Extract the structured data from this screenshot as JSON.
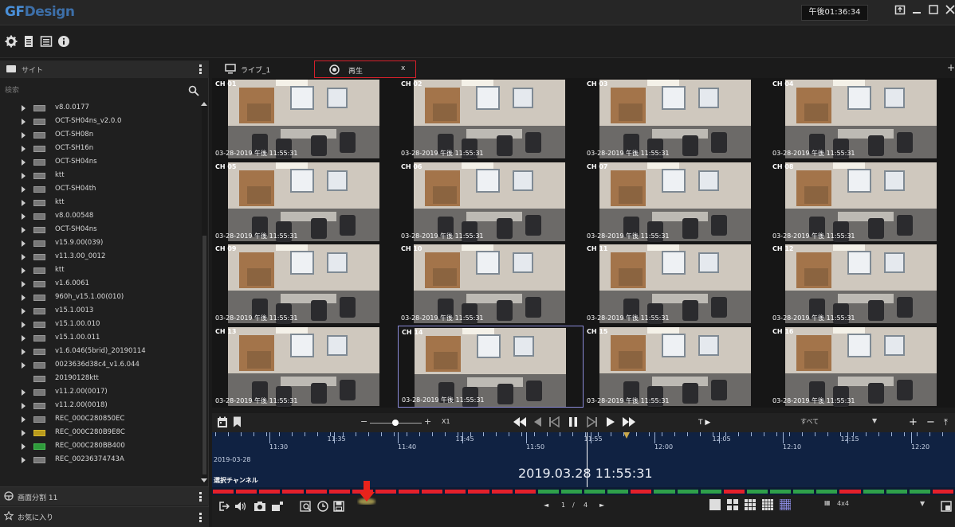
{
  "app": {
    "logo_gf": "GF",
    "logo_rest": "Design",
    "clock": "午後01:36:34"
  },
  "colors": {
    "accent": "#4a90d9",
    "tab_highlight": "#d6202b",
    "timeline_bg": "#102242",
    "record_red": "#e4202a",
    "record_green": "#2fa04a",
    "selected_cell": "#8a8ad8"
  },
  "toolbar": {
    "icons": [
      "gear-icon",
      "document-icon",
      "list-icon",
      "info-icon"
    ]
  },
  "sidebar": {
    "header_label": "サイト",
    "search_placeholder": "検索",
    "items": [
      {
        "label": "v8.0.0177",
        "color": "gray"
      },
      {
        "label": "OCT-SH04ns_v2.0.0",
        "color": "gray"
      },
      {
        "label": "OCT-SH08n",
        "color": "gray"
      },
      {
        "label": "OCT-SH16n",
        "color": "gray"
      },
      {
        "label": "OCT-SH04ns",
        "color": "gray"
      },
      {
        "label": "ktt",
        "color": "gray"
      },
      {
        "label": "OCT-SH04th",
        "color": "gray"
      },
      {
        "label": "ktt",
        "color": "gray"
      },
      {
        "label": "v8.0.00548",
        "color": "gray"
      },
      {
        "label": "OCT-SH04ns",
        "color": "gray"
      },
      {
        "label": "v15.9.00(039)",
        "color": "gray"
      },
      {
        "label": "v11.3.00_0012",
        "color": "gray"
      },
      {
        "label": "ktt",
        "color": "gray"
      },
      {
        "label": "v1.6.0061",
        "color": "gray"
      },
      {
        "label": "960h_v15.1.00(010)",
        "color": "gray"
      },
      {
        "label": "v15.1.0013",
        "color": "gray"
      },
      {
        "label": "v15.1.00.010",
        "color": "gray"
      },
      {
        "label": "v15.1.00.011",
        "color": "gray"
      },
      {
        "label": "v1.6.046(5brid)_20190114",
        "color": "gray"
      },
      {
        "label": "0023636d38c4_v1.6.044",
        "color": "gray"
      },
      {
        "label": "20190128ktt",
        "color": "gray"
      },
      {
        "label": "v11.2.00(0017)",
        "color": "gray"
      },
      {
        "label": "v11.2.00(0018)",
        "color": "gray"
      },
      {
        "label": "REC_000C280850EC",
        "color": "gray"
      },
      {
        "label": "REC_000C280B9E8C",
        "color": "yellow"
      },
      {
        "label": "REC_000C280BB400",
        "color": "green"
      },
      {
        "label": "REC_00236374743A",
        "color": "gray"
      }
    ],
    "footer1": "画面分割 11",
    "footer2": "お気に入り"
  },
  "tabs": {
    "live": "ライブ_1",
    "playback": "再生",
    "close": "x"
  },
  "cells": [
    {
      "ch": "CH 01",
      "ts": "03-28-2019 午後 11:55:31"
    },
    {
      "ch": "CH 02",
      "ts": "03-28-2019 午後 11:55:31"
    },
    {
      "ch": "CH 03",
      "ts": "03-28-2019 午後 11:55:31"
    },
    {
      "ch": "CH 04",
      "ts": "03-28-2019 午後 11:55:31"
    },
    {
      "ch": "CH 05",
      "ts": "03-28-2019 午後 11:55:31"
    },
    {
      "ch": "CH 06",
      "ts": "03-28-2019 午後 11:55:31"
    },
    {
      "ch": "CH 07",
      "ts": "03-28-2019 午後 11:55:31"
    },
    {
      "ch": "CH 08",
      "ts": "03-28-2019 午後 11:55:31"
    },
    {
      "ch": "CH 09",
      "ts": "03-28-2019 午後 11:55:31"
    },
    {
      "ch": "CH 10",
      "ts": "03-28-2019 午後 11:55:31"
    },
    {
      "ch": "CH 11",
      "ts": "03-28-2019 午後 11:55:31"
    },
    {
      "ch": "CH 12",
      "ts": "03-28-2019 午後 11:55:31"
    },
    {
      "ch": "CH 13",
      "ts": "03-28-2019 午後 11:55:31"
    },
    {
      "ch": "CH 14",
      "ts": "03-28-2019 午後 11:55:31"
    },
    {
      "ch": "CH 15",
      "ts": "03-28-2019 午後 11:55:31"
    },
    {
      "ch": "CH 16",
      "ts": "03-28-2019 午後 11:55:31"
    }
  ],
  "selected_cell_index": 13,
  "controls": {
    "speed": "X1",
    "filter": "すべて",
    "play_buttons": [
      "rewind-icon",
      "prev-icon",
      "step-back-icon",
      "pause-icon",
      "step-forward-icon",
      "play-icon",
      "fast-forward-icon"
    ],
    "t_play": "T ▶"
  },
  "timeline": {
    "ticks": [
      "11:30",
      "11:35",
      "11:40",
      "11:45",
      "11:50",
      "11:55",
      "12:00",
      "12:05",
      "12:10",
      "12:15",
      "12:20"
    ],
    "date": "2019-03-28",
    "current": "2019.03.28  11:55:31",
    "channel_label": "選択チャンネル"
  },
  "recording": {
    "segments": [
      "red",
      "red",
      "red",
      "red",
      "red",
      "red",
      "red",
      "red",
      "red",
      "red",
      "red",
      "red",
      "red",
      "red",
      "green",
      "green",
      "green",
      "green",
      "red",
      "green",
      "green",
      "green",
      "red",
      "green",
      "green",
      "green",
      "green",
      "red",
      "green",
      "green",
      "green",
      "red"
    ]
  },
  "pagination": {
    "current": "1",
    "separator": "/",
    "total": "4"
  },
  "layout": {
    "selected": "4x4"
  }
}
